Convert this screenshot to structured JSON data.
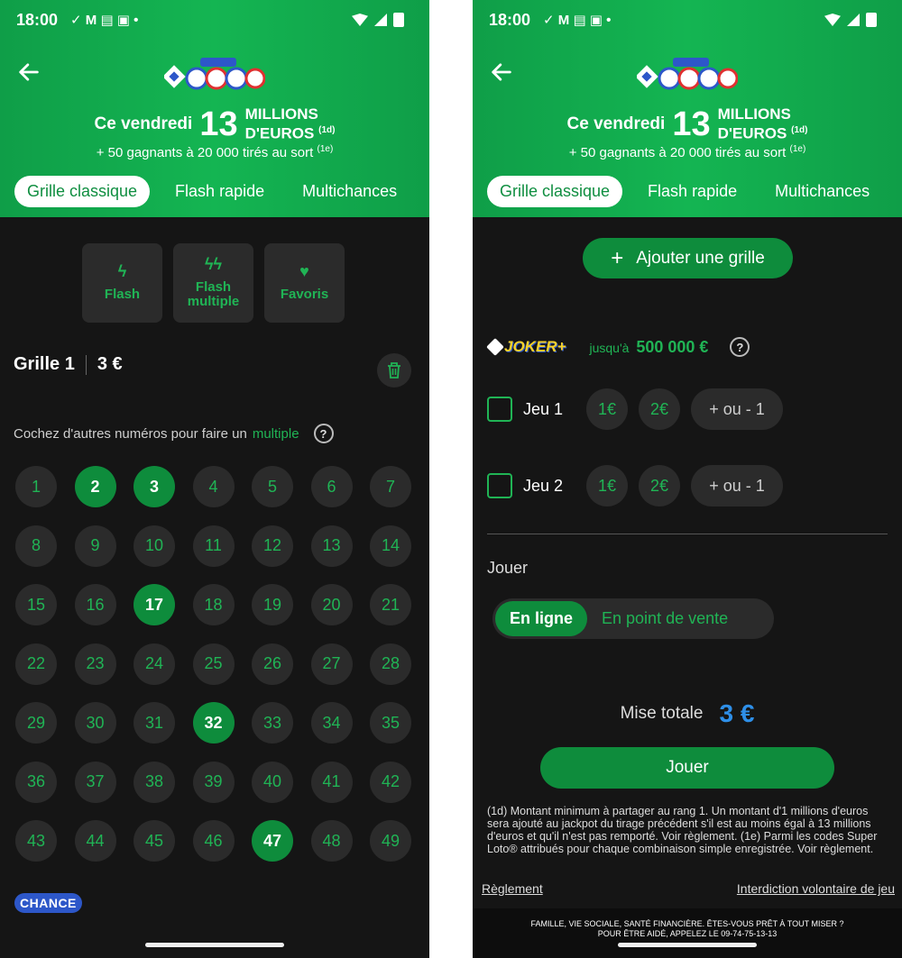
{
  "status_bar": {
    "time": "18:00"
  },
  "header": {
    "brand": "SUPER LOTO",
    "jackpot_prefix": "Ce vendredi",
    "jackpot_amount": "13",
    "jackpot_unit_line1": "MILLIONS",
    "jackpot_unit_line2": "D'EUROS",
    "jackpot_note": "(1d)",
    "subline": "+ 50 gagnants à 20 000 tirés au sort",
    "subline_note": "(1e)"
  },
  "tabs": [
    "Grille classique",
    "Flash rapide",
    "Multichances"
  ],
  "left": {
    "quick_actions": [
      {
        "label": "Flash",
        "icon": "lightning-icon"
      },
      {
        "label": "Flash multiple",
        "icon": "double-lightning-icon"
      },
      {
        "label": "Favoris",
        "icon": "heart-icon"
      }
    ],
    "grid_name": "Grille 1",
    "grid_price": "3 €",
    "hint_text": "Cochez d'autres numéros pour faire un",
    "hint_link": "multiple",
    "numbers": [
      1,
      2,
      3,
      4,
      5,
      6,
      7,
      8,
      9,
      10,
      11,
      12,
      13,
      14,
      15,
      16,
      17,
      18,
      19,
      20,
      21,
      22,
      23,
      24,
      25,
      26,
      27,
      28,
      29,
      30,
      31,
      32,
      33,
      34,
      35,
      36,
      37,
      38,
      39,
      40,
      41,
      42,
      43,
      44,
      45,
      46,
      47,
      48,
      49
    ],
    "selected": [
      2,
      3,
      17,
      32,
      47
    ],
    "chance_logo": "CHANCE"
  },
  "right": {
    "add_grid": "Ajouter une grille",
    "joker_logo": "JOKER+",
    "joker_up_to": "jusqu'à",
    "joker_amount": "500 000 €",
    "jeux": [
      {
        "label": "Jeu 1",
        "opt1": "1€",
        "opt2": "2€",
        "opt3": "+ ou - 1"
      },
      {
        "label": "Jeu 2",
        "opt1": "1€",
        "opt2": "2€",
        "opt3": "+ ou - 1"
      }
    ],
    "jouer_label": "Jouer",
    "mode_online": "En ligne",
    "mode_store": "En point de vente",
    "mise_label": "Mise totale",
    "mise_value": "3 €",
    "play_button": "Jouer",
    "footnote": "(1d) Montant minimum à partager au rang 1. Un montant d'1 millions d'euros sera ajouté au jackpot du tirage précédent s'il est au moins égal à 13 millions d'euros et qu'il n'est pas remporté. Voir règlement. (1e) Parmi les codes Super Loto® attribués pour chaque combinaison simple enregistrée. Voir règlement.",
    "link_rules": "Règlement",
    "link_ban": "Interdiction volontaire de jeu",
    "warning_line1": "FAMILLE, VIE SOCIALE, SANTÉ FINANCIÈRE. ÊTES-VOUS PRÊT À TOUT MISER ?",
    "warning_line2": "POUR ÊTRE AIDÉ, APPELEZ LE 09-74-75-13-13"
  },
  "colors": {
    "green": "#14b552",
    "dark_green": "#0e8c3c",
    "bg": "#151515",
    "pill": "#2b2b2b",
    "blue": "#2e8fe8"
  }
}
